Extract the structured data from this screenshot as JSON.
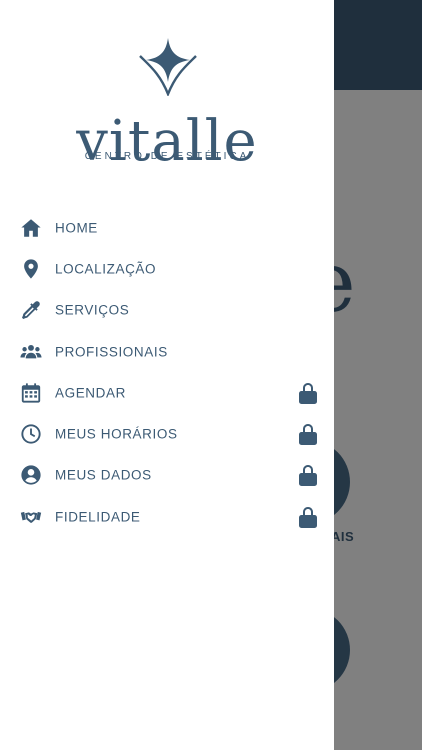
{
  "brand": {
    "name": "vitalle",
    "tagline": "CENTRO DE ESTÉTICA",
    "color": "#3c5a74"
  },
  "background": {
    "header_color": "#1f2f3d",
    "overlay_color": "#808080",
    "letter": "e",
    "label": "AIS"
  },
  "menu": [
    {
      "label": "HOME",
      "icon": "home-icon",
      "locked": false
    },
    {
      "label": "LOCALIZAÇÃO",
      "icon": "location-pin-icon",
      "locked": false
    },
    {
      "label": "SERVIÇOS",
      "icon": "eyedropper-icon",
      "locked": false
    },
    {
      "label": "PROFISSIONAIS",
      "icon": "users-icon",
      "locked": false
    },
    {
      "label": "AGENDAR",
      "icon": "calendar-icon",
      "locked": true
    },
    {
      "label": "MEUS HORÁRIOS",
      "icon": "clock-icon",
      "locked": true
    },
    {
      "label": "MEUS DADOS",
      "icon": "user-circle-icon",
      "locked": true
    },
    {
      "label": "FIDELIDADE",
      "icon": "handshake-icon",
      "locked": true
    }
  ]
}
